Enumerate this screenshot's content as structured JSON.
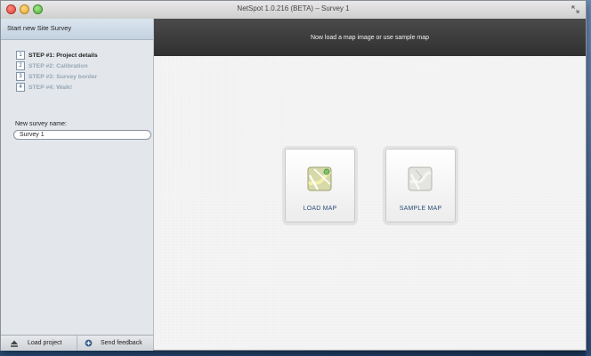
{
  "window": {
    "title": "NetSpot 1.0.216 (BETA) – Survey 1"
  },
  "sidebar": {
    "header": "Start new Site Survey",
    "steps": [
      {
        "num": "1",
        "label": "STEP #1: Project details",
        "active": true
      },
      {
        "num": "2",
        "label": "STEP #2: Calibration",
        "active": false
      },
      {
        "num": "3",
        "label": "STEP #3: Survey border",
        "active": false
      },
      {
        "num": "4",
        "label": "STEP #4: Walk!",
        "active": false
      }
    ],
    "survey_name_label": "New survey name:",
    "survey_name_value": "Survey 1",
    "footer": {
      "load_project": "Load project",
      "send_feedback": "Send feedback"
    }
  },
  "main": {
    "banner": "Now load a map image or use sample map",
    "load_map_label": "LOAD MAP",
    "sample_map_label": "SAMPLE MAP"
  },
  "colors": {
    "banner_bg": "#383838",
    "sidebar_bg": "#e3e7eb",
    "accent_text": "#2c4f7a",
    "desktop": "#2f5686"
  },
  "icons": {
    "load_map": "map-icon",
    "sample_map": "sample-map-icon",
    "load_project": "eject-icon",
    "send_feedback": "feedback-icon"
  }
}
